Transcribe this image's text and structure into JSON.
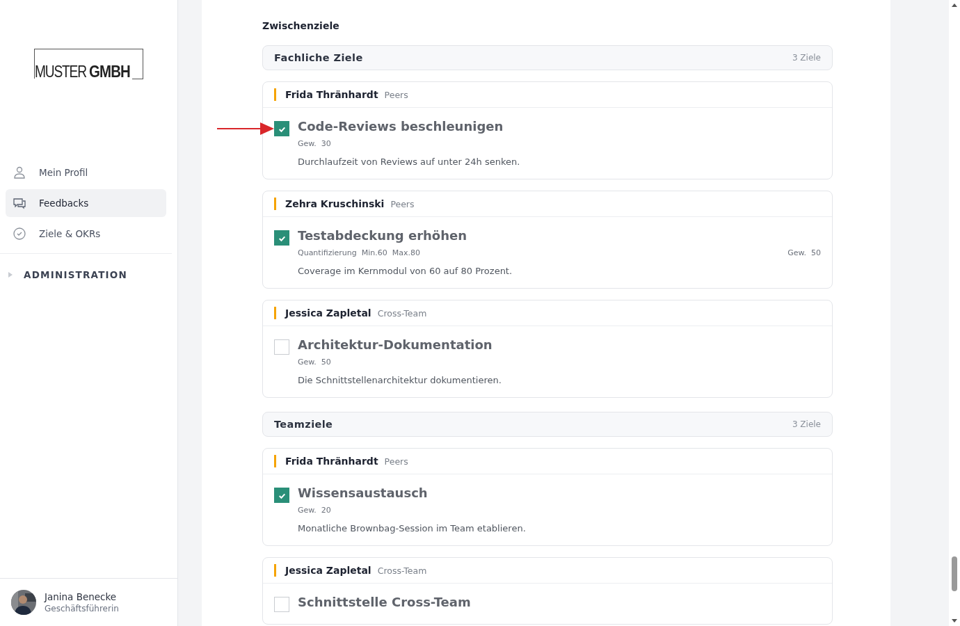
{
  "sidebar": {
    "logo": {
      "light": "MUSTER",
      "bold": "GMBH"
    },
    "nav": [
      {
        "label": "Mein Profil",
        "selected": false
      },
      {
        "label": "Feedbacks",
        "selected": true
      },
      {
        "label": "Ziele & OKRs",
        "selected": false
      }
    ],
    "admin": {
      "label": "ADMINISTRATION",
      "expanded": false
    },
    "user": {
      "name": "Janina Benecke",
      "role": "Geschäftsführerin"
    }
  },
  "main": {
    "heading": "Zwischenziele",
    "sections": [
      {
        "title": "Fachliche Ziele",
        "count": "3 Ziele",
        "cards": [
          {
            "person": "Frida Thränhardt",
            "relation": "Peers",
            "goal": {
              "title": "Code-Reviews beschleunigen",
              "checked": true,
              "highlighted": true,
              "kind": "simple",
              "weight_label": "Gew.",
              "weight": "30",
              "description": "Durchlaufzeit von Reviews auf unter 24h senken."
            }
          },
          {
            "person": "Zehra Kruschinski",
            "relation": "Peers",
            "goal": {
              "title": "Testabdeckung erhöhen",
              "checked": true,
              "highlighted": false,
              "kind": "quantified",
              "quantification": [
                "Quantifizierung",
                "Min.60",
                "Max.80"
              ],
              "weight_label": "Gew.",
              "weight": "50",
              "description": "Coverage im Kernmodul von 60 auf 80 Prozent."
            }
          },
          {
            "person": "Jessica Zapletal",
            "relation": "Cross-Team",
            "goal": {
              "title": "Architektur-Dokumentation",
              "checked": false,
              "highlighted": false,
              "kind": "simple",
              "weight_label": "Gew.",
              "weight": "50",
              "description": "Die Schnittstellenarchitektur dokumentieren."
            }
          }
        ]
      },
      {
        "title": "Teamziele",
        "count": "3 Ziele",
        "cards": [
          {
            "person": "Frida Thränhardt",
            "relation": "Peers",
            "goal": {
              "title": "Wissensaustausch",
              "checked": true,
              "highlighted": false,
              "kind": "simple",
              "weight_label": "Gew.",
              "weight": "20",
              "description": "Monatliche Brownbag-Session im Team etablieren."
            }
          },
          {
            "person": "Jessica Zapletal",
            "relation": "Cross-Team",
            "goal": {
              "title": "Schnittstelle Cross-Team",
              "checked": false,
              "highlighted": false,
              "kind": "simple"
            }
          }
        ]
      }
    ]
  }
}
